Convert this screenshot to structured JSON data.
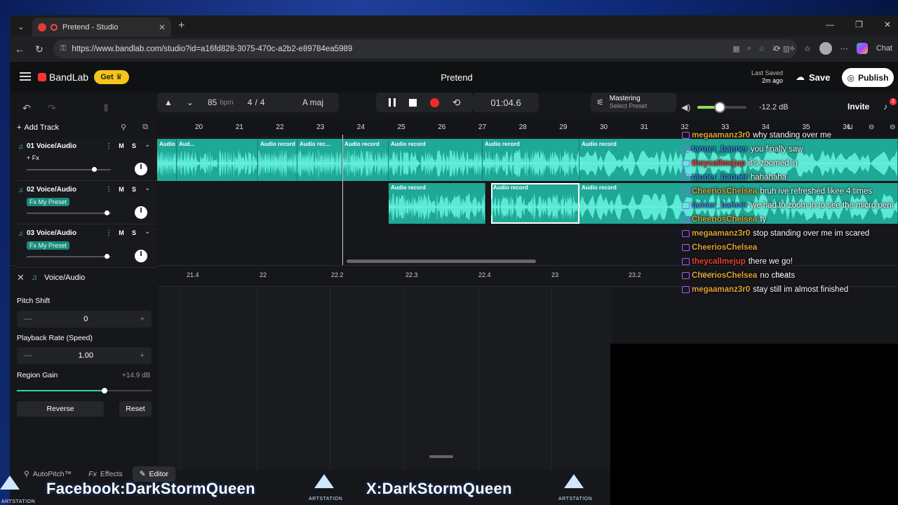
{
  "browser": {
    "tab_title": "Pretend - Studio",
    "url": "https://www.bandlab.com/studio?id=a16fd828-3075-470c-a2b2-e89784ea5989",
    "right_label": "Chat"
  },
  "app": {
    "logo": "BandLab",
    "get_label": "Get",
    "project_title": "Pretend",
    "last_saved_label": "Last Saved",
    "last_saved_value": "2m ago",
    "save_label": "Save",
    "publish_label": "Publish",
    "invite_label": "Invite",
    "notif_count": "1"
  },
  "transport": {
    "bpm": "85",
    "bpm_unit": "bpm",
    "time_sig_top": "4",
    "time_sig_bottom": "4",
    "key": "A maj",
    "time": "01:04.6",
    "mastering_label": "Mastering",
    "mastering_sub": "Select Preset",
    "db": "-12.2 dB",
    "volume_level": 0.45
  },
  "tracks_header": {
    "add_track": "Add Track"
  },
  "ruler": [
    "20",
    "21",
    "22",
    "23",
    "24",
    "25",
    "26",
    "27",
    "28",
    "29",
    "30",
    "31",
    "32",
    "33",
    "34",
    "35",
    "36"
  ],
  "tracks": [
    {
      "name": "01  Voice/Audio",
      "fx": "+ Fx",
      "m": "M",
      "s": "S",
      "volume": 0.8
    },
    {
      "name": "02  Voice/Audio",
      "fx": "Fx My Preset",
      "m": "M",
      "s": "S",
      "volume": 0.95
    },
    {
      "name": "03  Voice/Audio",
      "fx": "Fx My Preset",
      "m": "M",
      "s": "S",
      "volume": 0.95
    }
  ],
  "regions": {
    "track1": [
      "Audio record",
      "Aud...",
      "Audio record",
      "Audio rec...",
      "Audio record",
      "Audio record",
      "Audio record",
      "Audio record"
    ],
    "track2": [
      "Audio record",
      "Audio record",
      "Audio record",
      "Audio record"
    ]
  },
  "editor": {
    "title": "Voice/Audio",
    "ruler": [
      "21.4",
      "22",
      "22.2",
      "22.3",
      "22.4",
      "23",
      "23.2",
      "23.3",
      "23.4"
    ],
    "pitch_label": "Pitch Shift",
    "pitch_value": "0",
    "rate_label": "Playback Rate (Speed)",
    "rate_value": "1.00",
    "gain_label": "Region Gain",
    "gain_value": "+14.9 dB",
    "gain_level": 0.65,
    "reverse_label": "Reverse",
    "reset_label": "Reset",
    "tabs": [
      "AutoPitch™",
      "Effects",
      "Editor"
    ]
  },
  "chat": [
    {
      "user": "megaamanz3r0",
      "color": "#e0a23a",
      "text": "why standing over me"
    },
    {
      "user": "tanner_banner",
      "color": "#3a8fe0",
      "text": "you finally saw"
    },
    {
      "user": "theycallmejup",
      "color": "#e0423a",
      "text": "it's zoomed in"
    },
    {
      "user": "tanner_banner",
      "color": "#3a8fe0",
      "text": "hahahaha"
    },
    {
      "user": "CheeriosChelsea",
      "color": "#e0a23a",
      "text": "bruh ive refreshed likee 4 times"
    },
    {
      "user": "tanner_banner",
      "color": "#3a8fe0",
      "text": "we had to zoom in to see the micro peni"
    },
    {
      "user": "CheeriosChelsea",
      "color": "#e0a23a",
      "text": "ty"
    },
    {
      "user": "megaamanz3r0",
      "color": "#e0a23a",
      "text": "stop standing over me im scared"
    },
    {
      "user": "CheeriosChelsea",
      "color": "#e0a23a",
      "text": ""
    },
    {
      "user": "theycallmejup",
      "color": "#e0423a",
      "text": "there we go!"
    },
    {
      "user": "CheeriosChelsea",
      "color": "#e0a23a",
      "text": "no cheats"
    },
    {
      "user": "megaamanz3r0",
      "color": "#e0a23a",
      "text": "stay still im almost finished"
    }
  ],
  "overlay": {
    "facebook": "Facebook:DarkStormQueen",
    "x": "X:DarkStormQueen",
    "artstation": "ARTSTATION"
  }
}
